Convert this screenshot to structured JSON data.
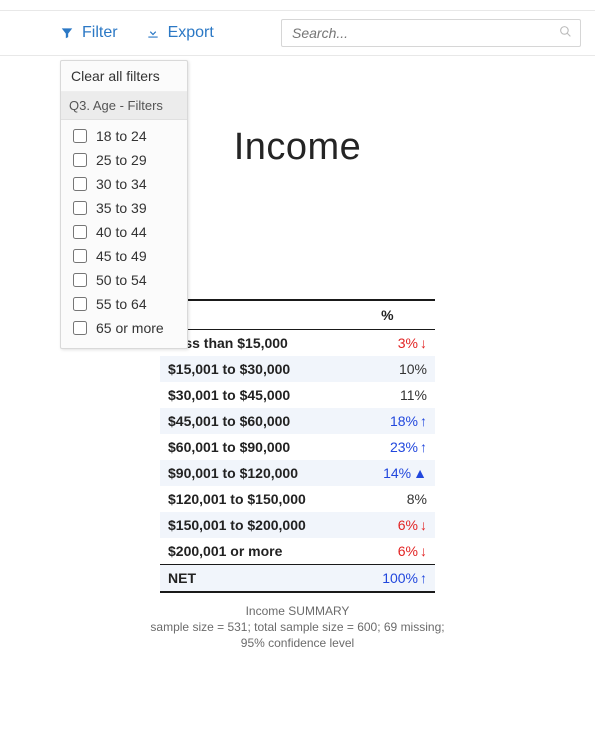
{
  "topbar": {
    "filter_label": "Filter",
    "export_label": "Export",
    "search_placeholder": "Search..."
  },
  "filter_panel": {
    "clear_label": "Clear all filters",
    "group_label": "Q3. Age - Filters",
    "options": [
      "18 to 24",
      "25 to 29",
      "30 to 34",
      "35 to 39",
      "40 to 44",
      "45 to 49",
      "50 to 54",
      "55 to 64",
      "65 or more"
    ]
  },
  "main": {
    "title": "Income"
  },
  "chart_data": {
    "type": "table",
    "title": "Income",
    "columns": [
      "",
      "%"
    ],
    "rows": [
      {
        "label": "Less than $15,000",
        "value": "3%",
        "direction": "down"
      },
      {
        "label": "$15,001 to $30,000",
        "value": "10%",
        "direction": null
      },
      {
        "label": "$30,001 to $45,000",
        "value": "11%",
        "direction": null
      },
      {
        "label": "$45,001 to $60,000",
        "value": "18%",
        "direction": "up"
      },
      {
        "label": "$60,001 to $90,000",
        "value": "23%",
        "direction": "up"
      },
      {
        "label": "$90,001 to $120,000",
        "value": "14%",
        "direction": "up-tri"
      },
      {
        "label": "$120,001 to $150,000",
        "value": "8%",
        "direction": null
      },
      {
        "label": "$150,001 to $200,000",
        "value": "6%",
        "direction": "down"
      },
      {
        "label": "$200,001 or more",
        "value": "6%",
        "direction": "down"
      }
    ],
    "net": {
      "label": "NET",
      "value": "100%",
      "direction": "up"
    },
    "caption_line1": "Income SUMMARY",
    "caption_line2": "sample size = 531; total sample size = 600; 69 missing; 95% confidence level"
  }
}
